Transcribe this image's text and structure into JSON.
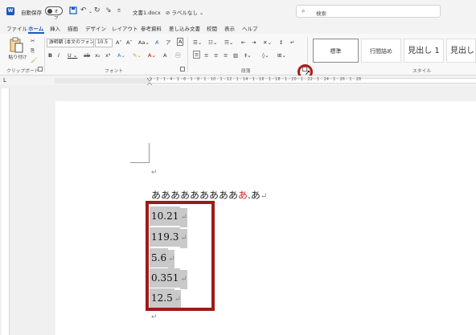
{
  "titlebar": {
    "autosave_label": "自動保存",
    "autosave_state": "オフ",
    "document_title": "文書1.docx",
    "label_status": "ラベルなし",
    "search_placeholder": "検索"
  },
  "tabs": [
    "ファイル",
    "ホーム",
    "挿入",
    "描画",
    "デザイン",
    "レイアウト",
    "参考資料",
    "差し込み文書",
    "校閲",
    "表示",
    "ヘルプ"
  ],
  "active_tab": "ホーム",
  "ribbon": {
    "paste_label": "貼り付け",
    "font_name": "游明朝 (本文のフォン",
    "font_size": "10.5",
    "group_clipboard": "クリップボード",
    "group_font": "フォント",
    "group_paragraph": "段落",
    "group_styles": "スタイル",
    "styles": [
      "標準",
      "行間詰め",
      "見出し 1",
      "見出し"
    ]
  },
  "ruler": {
    "numbers": "1 · 2 · 1 · 4 · 1 · 6 · 1 · 8 · 1 · 10 · 1 · 12 · 1 · 14 · 1 · 16 · 1 · 18 · 1 · 20 · 1 · 22 · 1 · 24 · 1 · 26 · 1 · 28"
  },
  "document": {
    "para_mark": "↵",
    "jp_text_main": "あああああああああ",
    "jp_text_red": "あ",
    "jp_text_tail": ".あ",
    "numbers": [
      "10.21",
      "119.3",
      "5.6",
      "0.351",
      "12.5"
    ]
  }
}
